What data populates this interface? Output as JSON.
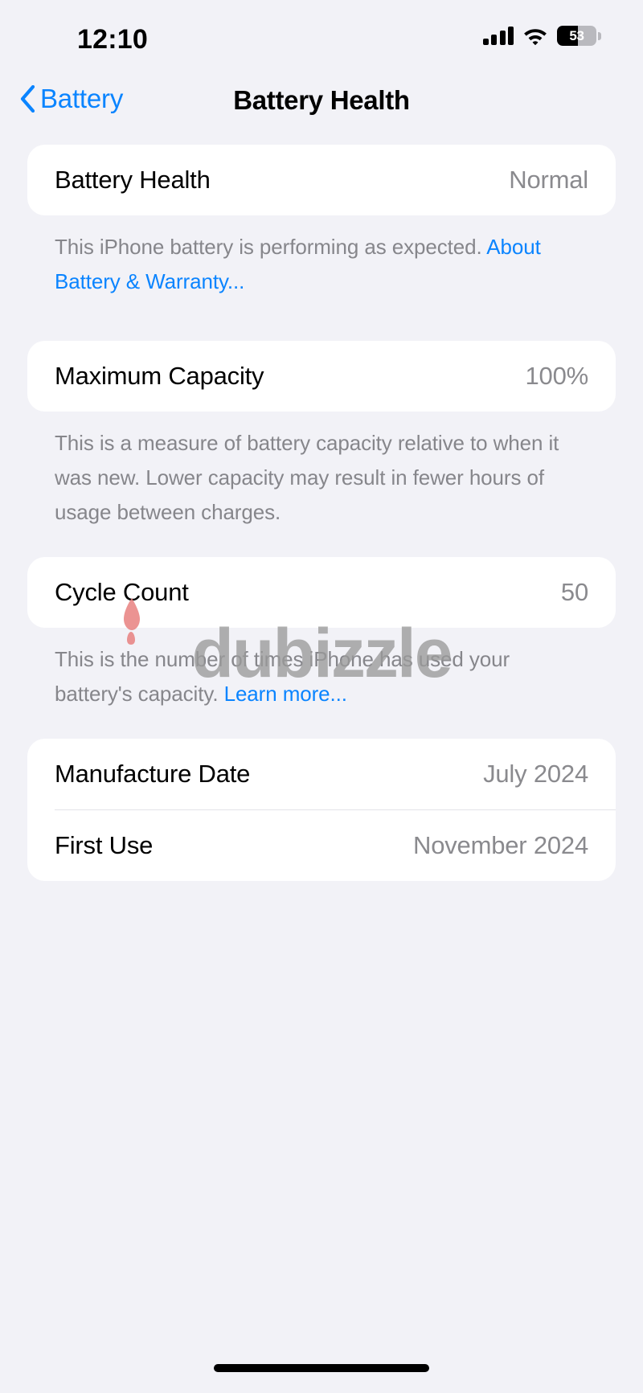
{
  "status_bar": {
    "time": "12:10",
    "battery_percent": "53",
    "battery_level": 53,
    "signal_bars": 4,
    "icons": [
      "cellular-signal-icon",
      "wifi-icon",
      "battery-icon"
    ]
  },
  "nav": {
    "back_label": "Battery",
    "title": "Battery Health"
  },
  "sections": {
    "battery_health": {
      "label": "Battery Health",
      "value": "Normal",
      "footer_text": "This iPhone battery is performing as expected. ",
      "footer_link": "About Battery & Warranty..."
    },
    "maximum_capacity": {
      "label": "Maximum Capacity",
      "value": "100%",
      "footer_text": "This is a measure of battery capacity relative to when it was new. Lower capacity may result in fewer hours of usage between charges."
    },
    "cycle_count": {
      "label": "Cycle Count",
      "value": "50",
      "footer_text": "This is the number of times iPhone has used your battery's capacity. ",
      "footer_link": "Learn more..."
    },
    "manufacture_date": {
      "label": "Manufacture Date",
      "value": "July 2024"
    },
    "first_use": {
      "label": "First Use",
      "value": "November 2024"
    }
  },
  "watermark": {
    "text": "dubizzle"
  },
  "colors": {
    "accent_blue": "#0A84FF",
    "background": "#F2F2F7",
    "card": "#FFFFFF",
    "secondary_text": "#8A8A8E",
    "watermark_gray": "#9A9A9A",
    "watermark_flame": "#E8807F"
  }
}
